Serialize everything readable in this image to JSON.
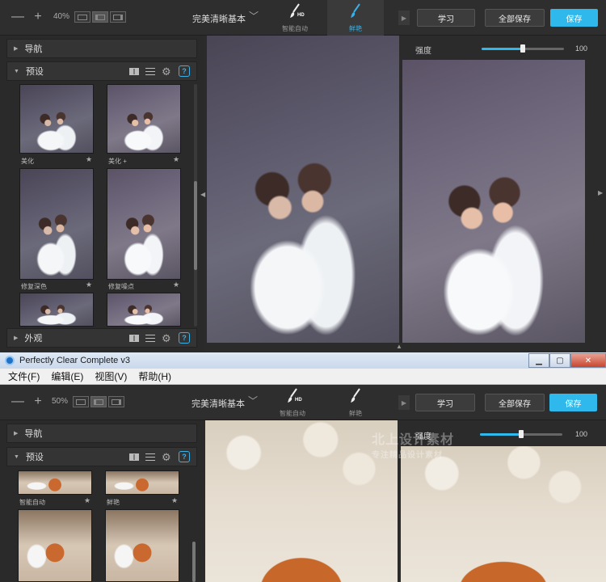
{
  "top_window": {
    "toolbar": {
      "zoom_minus": "—",
      "zoom_plus": "+",
      "zoom_level": "40%",
      "preset_name": "完美清晰基本",
      "tabs": [
        {
          "label": "智能自动",
          "badge": "HD",
          "icon": "brush-icon"
        },
        {
          "label": "鲜艳",
          "icon": "brush-icon"
        }
      ],
      "collapse": "▶"
    },
    "actions": {
      "learn": "学习",
      "save_all": "全部保存",
      "save": "保存"
    },
    "strength": {
      "label": "强度",
      "value": "100",
      "fraction": 0.5
    },
    "left_panel": {
      "nav_title": "导航",
      "presets_title": "预设",
      "appearance_title": "外观",
      "thumbs": [
        {
          "label": "美化",
          "star": "★"
        },
        {
          "label": "美化 +",
          "star": "★"
        },
        {
          "label": "修复深色",
          "star": "★"
        },
        {
          "label": "修复噪点",
          "star": "★"
        }
      ]
    }
  },
  "bottom_window": {
    "title": "Perfectly Clear Complete v3",
    "window_controls": [
      "▁",
      "▢",
      "✕"
    ],
    "menu": [
      "文件(F)",
      "编辑(E)",
      "视图(V)",
      "帮助(H)"
    ],
    "toolbar": {
      "zoom_minus": "—",
      "zoom_plus": "+",
      "zoom_level": "50%",
      "preset_name": "完美清晰基本",
      "tabs": [
        {
          "label": "智能自动",
          "badge": "HD",
          "icon": "brush-icon"
        },
        {
          "label": "鲜艳",
          "icon": "brush-icon"
        }
      ],
      "collapse": "▶"
    },
    "actions": {
      "learn": "学习",
      "save_all": "全部保存",
      "save": "保存"
    },
    "strength": {
      "label": "强度",
      "value": "100",
      "fraction": 0.5
    },
    "left_panel": {
      "nav_title": "导航",
      "presets_title": "预设",
      "thumbs": [
        {
          "label": "智能自动",
          "star": "★"
        },
        {
          "label": "鲜艳",
          "star": "★"
        }
      ]
    },
    "watermark": {
      "line1": "北上设计素材",
      "line2": "专注精品设计素材"
    }
  },
  "colors": {
    "accent": "#2eb8ec",
    "panel": "#2b2b2b",
    "help": "#3ab0e6"
  }
}
